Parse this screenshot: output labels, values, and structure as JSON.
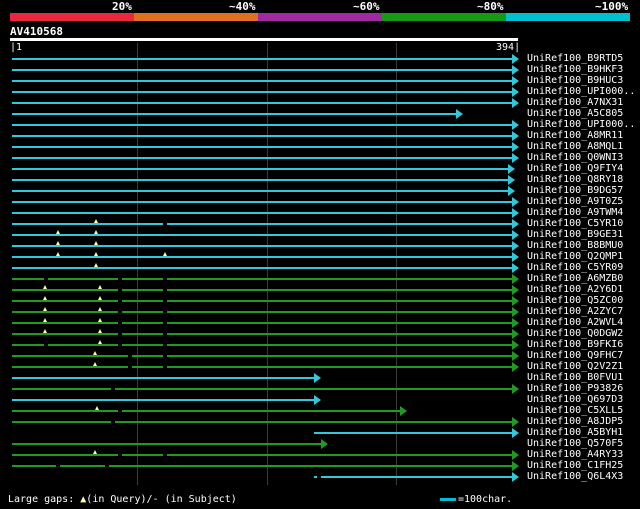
{
  "legend": {
    "segments": [
      {
        "label": "20%",
        "color": "#e8283c"
      },
      {
        "label": "~40%",
        "color": "#e07020"
      },
      {
        "label": "~60%",
        "color": "#a02aa0"
      },
      {
        "label": "~80%",
        "color": "#169a16"
      },
      {
        "label": "~100%",
        "color": "#00c0d0"
      }
    ]
  },
  "query": {
    "id": "AV410568",
    "start": "1",
    "end": "394"
  },
  "colors": {
    "cyan": "#32c8dc",
    "green": "#209a20",
    "navy": "#001060"
  },
  "hits": [
    {
      "label": "UniRef100_B9RTD5",
      "color": "cyan",
      "segments": [
        [
          1,
          394
        ]
      ],
      "arrow": true
    },
    {
      "label": "UniRef100_B9HKF3",
      "color": "cyan",
      "segments": [
        [
          1,
          394
        ]
      ],
      "arrow": true
    },
    {
      "label": "UniRef100_B9HUC3",
      "color": "cyan",
      "segments": [
        [
          1,
          394
        ]
      ],
      "arrow": true
    },
    {
      "label": "UniRef100_UPI000..",
      "color": "cyan",
      "segments": [
        [
          1,
          394
        ]
      ],
      "arrow": true
    },
    {
      "label": "UniRef100_A7NX31",
      "color": "cyan",
      "segments": [
        [
          1,
          394
        ]
      ],
      "arrow": true
    },
    {
      "label": "UniRef100_A5C805",
      "color": "cyan",
      "segments": [
        [
          1,
          350
        ]
      ],
      "arrow": true
    },
    {
      "label": "UniRef100_UPI000..",
      "color": "cyan",
      "segments": [
        [
          1,
          394
        ]
      ],
      "arrow": true
    },
    {
      "label": "UniRef100_A8MR11",
      "color": "cyan",
      "segments": [
        [
          1,
          394
        ]
      ],
      "arrow": true
    },
    {
      "label": "UniRef100_A8MQL1",
      "color": "cyan",
      "segments": [
        [
          1,
          394
        ]
      ],
      "arrow": true
    },
    {
      "label": "UniRef100_Q0WNI3",
      "color": "cyan",
      "segments": [
        [
          1,
          394
        ]
      ],
      "arrow": true
    },
    {
      "label": "UniRef100_Q9FIY4",
      "color": "cyan",
      "segments": [
        [
          1,
          391
        ]
      ],
      "arrow": true
    },
    {
      "label": "UniRef100_Q8RY18",
      "color": "cyan",
      "segments": [
        [
          1,
          391
        ]
      ],
      "arrow": true
    },
    {
      "label": "UniRef100_B9DG57",
      "color": "cyan",
      "segments": [
        [
          1,
          391
        ]
      ],
      "arrow": true
    },
    {
      "label": "UniRef100_A9T0Z5",
      "color": "cyan",
      "segments": [
        [
          1,
          394
        ]
      ],
      "arrow": true
    },
    {
      "label": "UniRef100_A9TWM4",
      "color": "cyan",
      "segments": [
        [
          1,
          394
        ]
      ],
      "arrow": true
    },
    {
      "label": "UniRef100_C5YR10",
      "color": "cyan",
      "segments": [
        [
          1,
          394
        ]
      ],
      "arrow": true,
      "qgaps": [
        67
      ],
      "sgaps": [
        121
      ]
    },
    {
      "label": "UniRef100_B9GE31",
      "color": "cyan",
      "segments": [
        [
          1,
          394
        ]
      ],
      "arrow": true,
      "qgaps": [
        37,
        67
      ]
    },
    {
      "label": "UniRef100_B8BMU0",
      "color": "cyan",
      "segments": [
        [
          1,
          394
        ]
      ],
      "arrow": true,
      "qgaps": [
        37,
        67
      ]
    },
    {
      "label": "UniRef100_Q2QMP1",
      "color": "cyan",
      "segments": [
        [
          1,
          394
        ]
      ],
      "arrow": true,
      "qgaps": [
        37,
        67,
        121
      ]
    },
    {
      "label": "UniRef100_C5YR09",
      "color": "cyan",
      "segments": [
        [
          1,
          394
        ]
      ],
      "arrow": true,
      "qgaps": [
        67
      ]
    },
    {
      "label": "UniRef100_A6MZB0",
      "color": "green",
      "segments": [
        [
          1,
          394
        ]
      ],
      "arrow": true,
      "sgaps": [
        28,
        86,
        121
      ]
    },
    {
      "label": "UniRef100_A2Y6D1",
      "color": "green",
      "segments": [
        [
          1,
          394
        ]
      ],
      "arrow": true,
      "qgaps": [
        27,
        70
      ],
      "sgaps": [
        86,
        121
      ]
    },
    {
      "label": "UniRef100_Q5ZC00",
      "color": "green",
      "segments": [
        [
          1,
          394
        ]
      ],
      "arrow": true,
      "qgaps": [
        27,
        70
      ],
      "sgaps": [
        86,
        121
      ]
    },
    {
      "label": "UniRef100_A2ZYC7",
      "color": "green",
      "segments": [
        [
          1,
          394
        ]
      ],
      "arrow": true,
      "qgaps": [
        27,
        70
      ],
      "sgaps": [
        86,
        121
      ]
    },
    {
      "label": "UniRef100_A2WVL4",
      "color": "green",
      "segments": [
        [
          1,
          394
        ]
      ],
      "arrow": true,
      "qgaps": [
        27,
        70
      ],
      "sgaps": [
        86,
        121
      ]
    },
    {
      "label": "UniRef100_Q0DGW2",
      "color": "green",
      "segments": [
        [
          1,
          394
        ]
      ],
      "arrow": true,
      "qgaps": [
        27,
        70
      ],
      "sgaps": [
        86,
        121
      ]
    },
    {
      "label": "UniRef100_B9FKI6",
      "color": "green",
      "segments": [
        [
          1,
          394
        ]
      ],
      "arrow": true,
      "qgaps": [
        70
      ],
      "sgaps": [
        28,
        86,
        121
      ]
    },
    {
      "label": "UniRef100_Q9FHC7",
      "color": "green",
      "segments": [
        [
          1,
          394
        ]
      ],
      "arrow": true,
      "qgaps": [
        66
      ],
      "sgaps": [
        94,
        121
      ]
    },
    {
      "label": "UniRef100_Q2V2Z1",
      "color": "green",
      "segments": [
        [
          1,
          394
        ]
      ],
      "arrow": true,
      "qgaps": [
        66
      ],
      "sgaps": [
        94,
        121
      ]
    },
    {
      "label": "UniRef100_B0FVU1",
      "color": "cyan",
      "segments": [
        [
          1,
          238
        ]
      ],
      "arrow": true
    },
    {
      "label": "UniRef100_P93826",
      "color": "green",
      "segments": [
        [
          1,
          394
        ]
      ],
      "arrow": true,
      "sgaps": [
        80
      ]
    },
    {
      "label": "UniRef100_Q697D3",
      "color": "cyan",
      "segments": [
        [
          1,
          238
        ]
      ],
      "arrow": true
    },
    {
      "label": "UniRef100_C5XLL5",
      "color": "green",
      "segments": [
        [
          1,
          306
        ]
      ],
      "arrow": true,
      "qgaps": [
        68
      ],
      "sgaps": [
        86
      ]
    },
    {
      "label": "UniRef100_A8JDP5",
      "color": "green",
      "segments": [
        [
          1,
          394
        ]
      ],
      "arrow": true,
      "sgaps": [
        80
      ]
    },
    {
      "label": "UniRef100_A5BYH1",
      "color": "cyan",
      "segments": [
        [
          238,
          394
        ]
      ],
      "arrow": true
    },
    {
      "label": "UniRef100_Q570F5",
      "color": "green",
      "segments": [
        [
          1,
          244
        ]
      ],
      "arrow": true
    },
    {
      "label": "UniRef100_A4RY33",
      "color": "green",
      "segments": [
        [
          1,
          394
        ]
      ],
      "arrow": true,
      "qgaps": [
        66
      ],
      "sgaps": [
        86,
        121
      ]
    },
    {
      "label": "UniRef100_C1FH25",
      "color": "green",
      "segments": [
        [
          1,
          394
        ]
      ],
      "arrow": true,
      "sgaps": [
        37,
        76
      ]
    },
    {
      "label": "UniRef100_Q6L4X3",
      "color": "cyan",
      "segments": [
        [
          238,
          394
        ]
      ],
      "arrow": true,
      "sgaps": [
        242
      ]
    }
  ],
  "footer": {
    "gaps_label": "Large gaps:",
    "query_gap": "(in Query)/",
    "subject_gap": "- (in Subject)",
    "scale_label": "=100char."
  }
}
